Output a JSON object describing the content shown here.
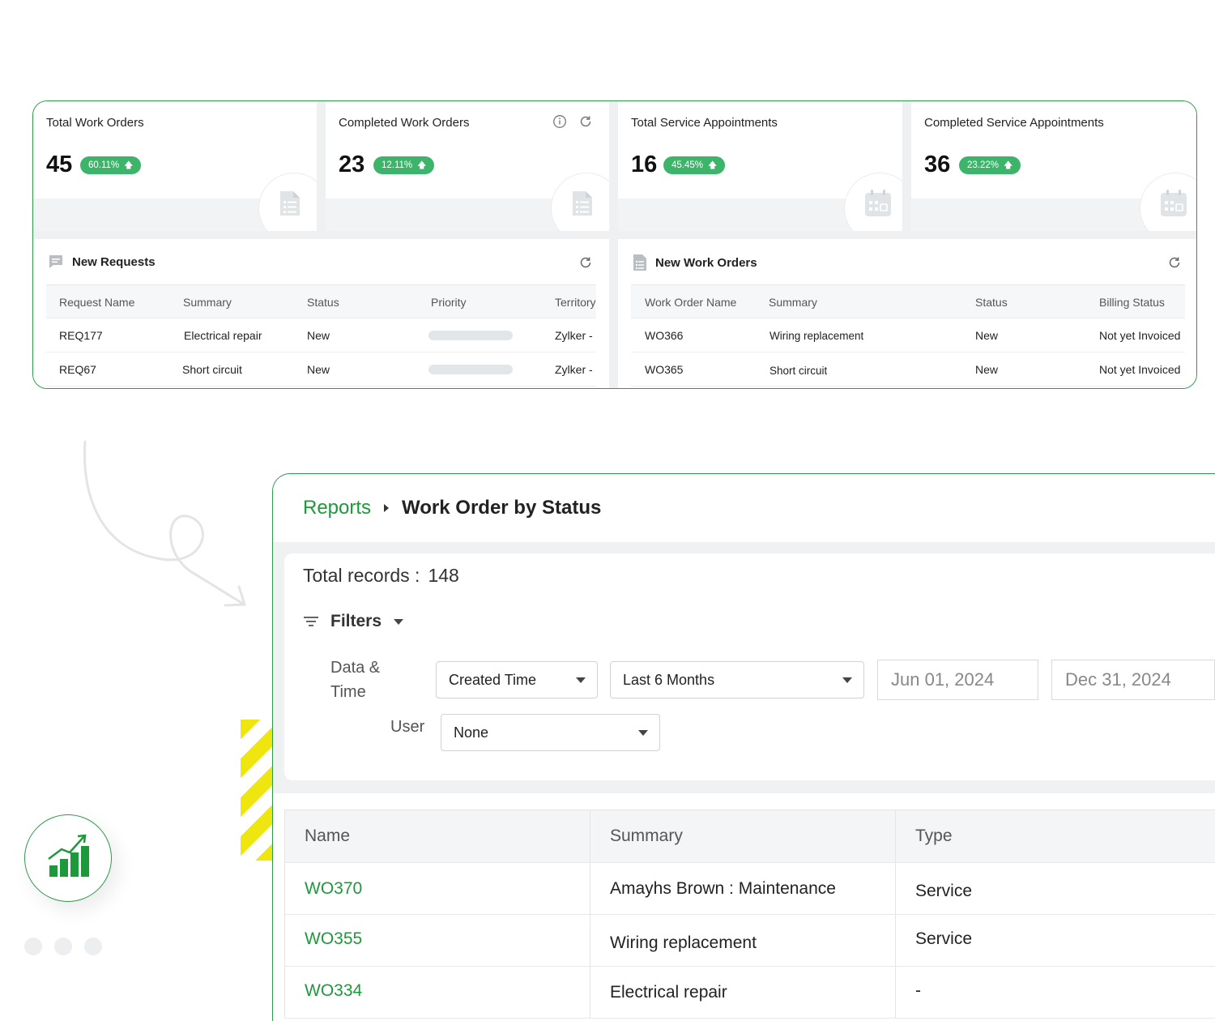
{
  "kpis": [
    {
      "title": "Total Work Orders",
      "value": "45",
      "change": "60.11%"
    },
    {
      "title": "Completed Work Orders",
      "value": "23",
      "change": "12.11%"
    },
    {
      "title": "Total Service Appointments",
      "value": "16",
      "change": "45.45%"
    },
    {
      "title": "Completed Service Appointments",
      "value": "36",
      "change": "23.22%"
    }
  ],
  "new_requests": {
    "title": "New Requests",
    "columns": [
      "Request Name",
      "Summary",
      "Status",
      "Priority",
      "Territory"
    ],
    "rows": [
      {
        "name": "REQ177",
        "summary": "Electrical repair",
        "status": "New",
        "territory": "Zylker -"
      },
      {
        "name": "REQ67",
        "summary": "Short circuit",
        "status": "New",
        "territory": "Zylker -"
      }
    ]
  },
  "new_work_orders": {
    "title": "New Work Orders",
    "columns": [
      "Work Order Name",
      "Summary",
      "Status",
      "Billing Status"
    ],
    "rows": [
      {
        "name": "WO366",
        "summary": "Wiring replacement",
        "status": "New",
        "billing": "Not yet Invoiced"
      },
      {
        "name": "WO365",
        "summary": "Short circuit",
        "status": "New",
        "billing": "Not yet Invoiced"
      }
    ]
  },
  "report": {
    "breadcrumb_root": "Reports",
    "title": "Work Order by Status",
    "total_label": "Total records :",
    "total_value": "148",
    "filters_label": "Filters",
    "date_label_1": "Data &",
    "date_label_2": "Time",
    "date_field": "Created Time",
    "date_range": "Last 6 Months",
    "date_from": "Jun 01, 2024",
    "date_to": "Dec 31, 2024",
    "user_label": "User",
    "user_value": "None",
    "columns": [
      "Name",
      "Summary",
      "Type"
    ],
    "rows": [
      {
        "name": "WO370",
        "summary": "Amayhs Brown : Maintenance",
        "type": "Service"
      },
      {
        "name": "WO355",
        "summary": "Wiring replacement",
        "type": "Service"
      },
      {
        "name": "WO334",
        "summary": "Electrical repair",
        "type": "-"
      }
    ]
  },
  "icons": [
    "info-icon",
    "refresh-icon",
    "document-icon",
    "calendar-icon",
    "chat-icon",
    "filter-icon",
    "chart-growth-icon"
  ],
  "colors": {
    "accent": "#1c9a3b",
    "badge": "#3cb56a",
    "border": "#2e9b4c",
    "stripe": "#f0e60f"
  }
}
